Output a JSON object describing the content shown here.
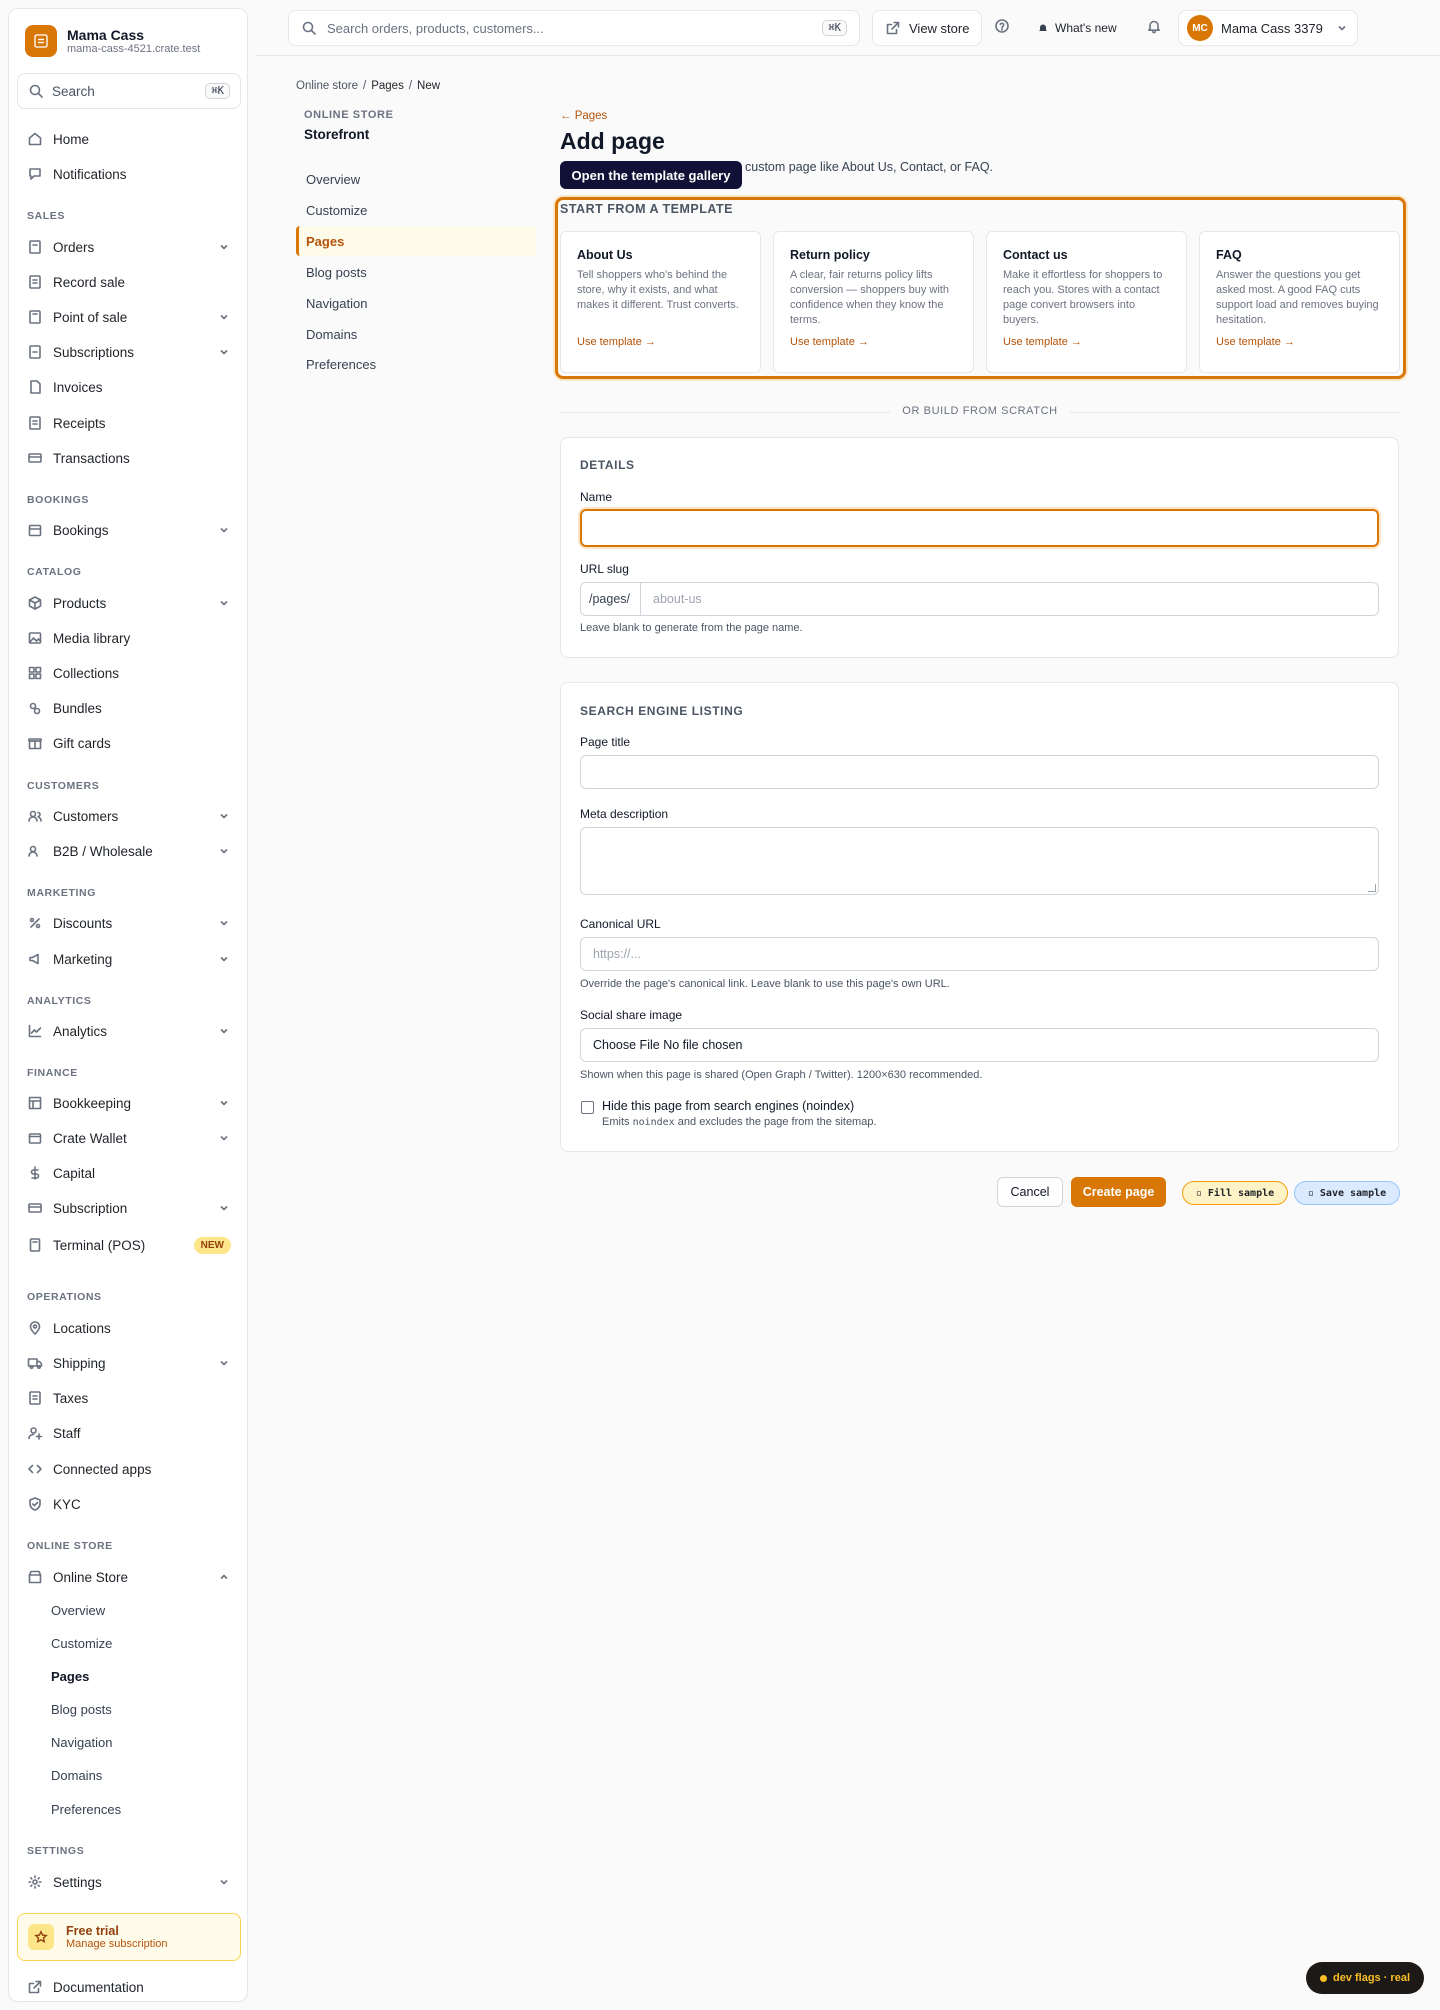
{
  "sidebar": {
    "brand_name": "Mama Cass",
    "brand_domain": "mama-cass-4521.crate.test",
    "search_placeholder": "Search",
    "search_shortcut": "⌘K",
    "items": {
      "home": "Home",
      "notifications": "Notifications",
      "orders": "Orders",
      "record_sale": "Record sale",
      "pos": "Point of sale",
      "subscriptions": "Subscriptions",
      "invoices": "Invoices",
      "receipts": "Receipts",
      "transactions": "Transactions",
      "bookings": "Bookings",
      "products": "Products",
      "media": "Media library",
      "collections": "Collections",
      "bundles": "Bundles",
      "giftcards": "Gift cards",
      "customers": "Customers",
      "b2b": "B2B / Wholesale",
      "discounts": "Discounts",
      "marketing": "Marketing",
      "analytics": "Analytics",
      "bookkeeping": "Bookkeeping",
      "wallet": "Crate Wallet",
      "capital": "Capital",
      "subscription": "Subscription",
      "terminal": "Terminal (POS)",
      "terminal_badge": "NEW",
      "locations": "Locations",
      "shipping": "Shipping",
      "taxes": "Taxes",
      "staff": "Staff",
      "apps": "Connected apps",
      "kyc": "KYC",
      "online_store": "Online Store",
      "settings": "Settings",
      "documentation": "Documentation"
    },
    "sections": {
      "sales": "SALES",
      "bookings": "BOOKINGS",
      "catalog": "CATALOG",
      "customers": "CUSTOMERS",
      "marketing": "MARKETING",
      "analytics": "ANALYTICS",
      "finance": "FINANCE",
      "operations": "OPERATIONS",
      "online_store": "ONLINE STORE",
      "settings": "SETTINGS"
    },
    "online_store_sub": [
      "Overview",
      "Customize",
      "Pages",
      "Blog posts",
      "Navigation",
      "Domains",
      "Preferences"
    ],
    "trial": {
      "title": "Free trial",
      "link": "Manage subscription"
    }
  },
  "topbar": {
    "search_placeholder": "Search orders, products, customers...",
    "search_shortcut": "⌘K",
    "view_store": "View store",
    "whats_new": "What's new",
    "user_initials": "MC",
    "user_name": "Mama Cass 3379"
  },
  "breadcrumb": [
    "Online store",
    "/",
    "Pages",
    "/",
    "New"
  ],
  "subnav": {
    "heading": "ONLINE STORE",
    "title": "Storefront",
    "items": [
      "Overview",
      "Customize",
      "Pages",
      "Blog posts",
      "Navigation",
      "Domains",
      "Preferences"
    ]
  },
  "main": {
    "back": "← Pages",
    "title": "Add page",
    "description": "custom page like About Us, Contact, or FAQ.",
    "tooltip": "Open the template gallery",
    "templates_heading": "START FROM A TEMPLATE",
    "templates": [
      {
        "title": "About Us",
        "desc": "Tell shoppers who's behind the store, why it exists, and what makes it different. Trust converts.",
        "link": "Use template →"
      },
      {
        "title": "Return policy",
        "desc": "A clear, fair returns policy lifts conversion — shoppers buy with confidence when they know the terms.",
        "link": "Use template →"
      },
      {
        "title": "Contact us",
        "desc": "Make it effortless for shoppers to reach you. Stores with a contact page convert browsers into buyers.",
        "link": "Use template →"
      },
      {
        "title": "FAQ",
        "desc": "Answer the questions you get asked most. A good FAQ cuts support load and removes buying hesitation.",
        "link": "Use template →"
      }
    ],
    "divider": "OR BUILD FROM SCRATCH",
    "details": {
      "heading": "DETAILS",
      "name_label": "Name",
      "name_value": "",
      "slug_label": "URL slug",
      "slug_prefix": "/pages/",
      "slug_placeholder": "about-us",
      "slug_help": "Leave blank to generate from the page name."
    },
    "seo": {
      "heading": "SEARCH ENGINE LISTING",
      "page_title_label": "Page title",
      "meta_label": "Meta description",
      "canonical_label": "Canonical URL",
      "canonical_placeholder": "https://...",
      "canonical_help": "Override the page's canonical link. Leave blank to use this page's own URL.",
      "share_label": "Social share image",
      "file_button": "Choose File",
      "file_status": "No file chosen",
      "share_help": "Shown when this page is shared (Open Graph / Twitter). 1200×630 recommended.",
      "noindex_label": "Hide this page from search engines (noindex)",
      "noindex_help_pre": "Emits",
      "noindex_code": "noindex",
      "noindex_help_post": "and excludes the page from the sitemap."
    },
    "actions": {
      "cancel": "Cancel",
      "create": "Create page",
      "fill_sample": "Fill sample",
      "save_sample": "Save sample"
    }
  },
  "dev_flags": "dev flags · real",
  "colors": {
    "accent": "#d97706",
    "accent_text": "#b45309"
  }
}
